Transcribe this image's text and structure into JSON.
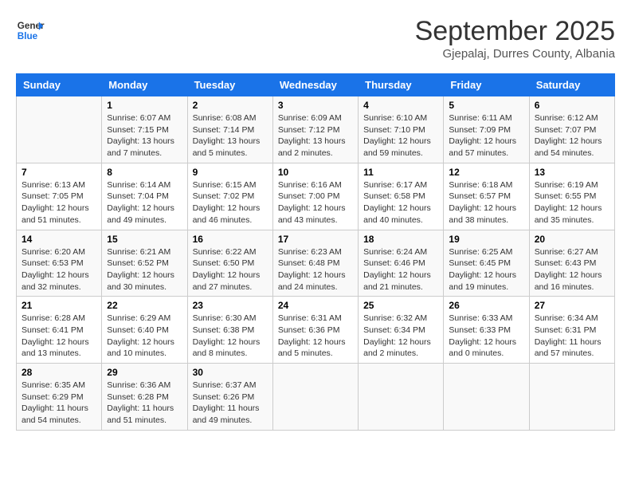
{
  "header": {
    "logo_general": "General",
    "logo_blue": "Blue",
    "month_title": "September 2025",
    "location": "Gjepalaj, Durres County, Albania"
  },
  "days_of_week": [
    "Sunday",
    "Monday",
    "Tuesday",
    "Wednesday",
    "Thursday",
    "Friday",
    "Saturday"
  ],
  "weeks": [
    [
      {
        "day": "",
        "content": ""
      },
      {
        "day": "1",
        "content": "Sunrise: 6:07 AM\nSunset: 7:15 PM\nDaylight: 13 hours\nand 7 minutes."
      },
      {
        "day": "2",
        "content": "Sunrise: 6:08 AM\nSunset: 7:14 PM\nDaylight: 13 hours\nand 5 minutes."
      },
      {
        "day": "3",
        "content": "Sunrise: 6:09 AM\nSunset: 7:12 PM\nDaylight: 13 hours\nand 2 minutes."
      },
      {
        "day": "4",
        "content": "Sunrise: 6:10 AM\nSunset: 7:10 PM\nDaylight: 12 hours\nand 59 minutes."
      },
      {
        "day": "5",
        "content": "Sunrise: 6:11 AM\nSunset: 7:09 PM\nDaylight: 12 hours\nand 57 minutes."
      },
      {
        "day": "6",
        "content": "Sunrise: 6:12 AM\nSunset: 7:07 PM\nDaylight: 12 hours\nand 54 minutes."
      }
    ],
    [
      {
        "day": "7",
        "content": "Sunrise: 6:13 AM\nSunset: 7:05 PM\nDaylight: 12 hours\nand 51 minutes."
      },
      {
        "day": "8",
        "content": "Sunrise: 6:14 AM\nSunset: 7:04 PM\nDaylight: 12 hours\nand 49 minutes."
      },
      {
        "day": "9",
        "content": "Sunrise: 6:15 AM\nSunset: 7:02 PM\nDaylight: 12 hours\nand 46 minutes."
      },
      {
        "day": "10",
        "content": "Sunrise: 6:16 AM\nSunset: 7:00 PM\nDaylight: 12 hours\nand 43 minutes."
      },
      {
        "day": "11",
        "content": "Sunrise: 6:17 AM\nSunset: 6:58 PM\nDaylight: 12 hours\nand 40 minutes."
      },
      {
        "day": "12",
        "content": "Sunrise: 6:18 AM\nSunset: 6:57 PM\nDaylight: 12 hours\nand 38 minutes."
      },
      {
        "day": "13",
        "content": "Sunrise: 6:19 AM\nSunset: 6:55 PM\nDaylight: 12 hours\nand 35 minutes."
      }
    ],
    [
      {
        "day": "14",
        "content": "Sunrise: 6:20 AM\nSunset: 6:53 PM\nDaylight: 12 hours\nand 32 minutes."
      },
      {
        "day": "15",
        "content": "Sunrise: 6:21 AM\nSunset: 6:52 PM\nDaylight: 12 hours\nand 30 minutes."
      },
      {
        "day": "16",
        "content": "Sunrise: 6:22 AM\nSunset: 6:50 PM\nDaylight: 12 hours\nand 27 minutes."
      },
      {
        "day": "17",
        "content": "Sunrise: 6:23 AM\nSunset: 6:48 PM\nDaylight: 12 hours\nand 24 minutes."
      },
      {
        "day": "18",
        "content": "Sunrise: 6:24 AM\nSunset: 6:46 PM\nDaylight: 12 hours\nand 21 minutes."
      },
      {
        "day": "19",
        "content": "Sunrise: 6:25 AM\nSunset: 6:45 PM\nDaylight: 12 hours\nand 19 minutes."
      },
      {
        "day": "20",
        "content": "Sunrise: 6:27 AM\nSunset: 6:43 PM\nDaylight: 12 hours\nand 16 minutes."
      }
    ],
    [
      {
        "day": "21",
        "content": "Sunrise: 6:28 AM\nSunset: 6:41 PM\nDaylight: 12 hours\nand 13 minutes."
      },
      {
        "day": "22",
        "content": "Sunrise: 6:29 AM\nSunset: 6:40 PM\nDaylight: 12 hours\nand 10 minutes."
      },
      {
        "day": "23",
        "content": "Sunrise: 6:30 AM\nSunset: 6:38 PM\nDaylight: 12 hours\nand 8 minutes."
      },
      {
        "day": "24",
        "content": "Sunrise: 6:31 AM\nSunset: 6:36 PM\nDaylight: 12 hours\nand 5 minutes."
      },
      {
        "day": "25",
        "content": "Sunrise: 6:32 AM\nSunset: 6:34 PM\nDaylight: 12 hours\nand 2 minutes."
      },
      {
        "day": "26",
        "content": "Sunrise: 6:33 AM\nSunset: 6:33 PM\nDaylight: 12 hours\nand 0 minutes."
      },
      {
        "day": "27",
        "content": "Sunrise: 6:34 AM\nSunset: 6:31 PM\nDaylight: 11 hours\nand 57 minutes."
      }
    ],
    [
      {
        "day": "28",
        "content": "Sunrise: 6:35 AM\nSunset: 6:29 PM\nDaylight: 11 hours\nand 54 minutes."
      },
      {
        "day": "29",
        "content": "Sunrise: 6:36 AM\nSunset: 6:28 PM\nDaylight: 11 hours\nand 51 minutes."
      },
      {
        "day": "30",
        "content": "Sunrise: 6:37 AM\nSunset: 6:26 PM\nDaylight: 11 hours\nand 49 minutes."
      },
      {
        "day": "",
        "content": ""
      },
      {
        "day": "",
        "content": ""
      },
      {
        "day": "",
        "content": ""
      },
      {
        "day": "",
        "content": ""
      }
    ]
  ]
}
